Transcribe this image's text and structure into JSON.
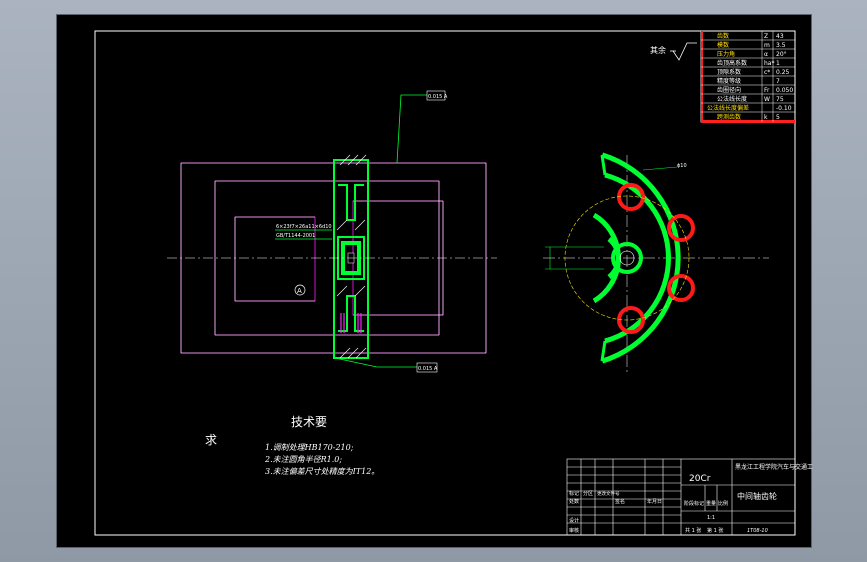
{
  "drawing": {
    "technical_requirements": {
      "title": "技术要",
      "title_tail": "求",
      "items": [
        "1.调制处理HB170-210;",
        "2.未注圆角半径R1.0;",
        "3.未注偏差尺寸处精度为IT12。"
      ]
    },
    "roughness_note": "其余",
    "title_block": {
      "material": "20Cr",
      "university": "黑龙江工程学院汽车与交通工程学院",
      "part_name": "中间轴齿轮",
      "drawing_no": "1T08-10",
      "scale": "1:1",
      "labels": [
        "标记",
        "处数",
        "分区",
        "更改文件号",
        "签名",
        "年月日",
        "设计",
        "标准化",
        "审核",
        "工艺",
        "批准",
        "阶段标记",
        "重量",
        "比例",
        "共 1 张",
        "第 1 张"
      ]
    },
    "params_table": {
      "rows": [
        {
          "name": "齿数",
          "sym": "Z",
          "val": "43"
        },
        {
          "name": "模数",
          "sym": "m",
          "val": "3.5"
        },
        {
          "name": "压力角",
          "sym": "α",
          "val": "20°"
        },
        {
          "name": "齿顶高系数",
          "sym": "ha*",
          "val": "1"
        },
        {
          "name": "顶隙系数",
          "sym": "c*",
          "val": "0.25"
        },
        {
          "name": "精度等级",
          "sym": "",
          "val": "7"
        },
        {
          "name": "齿圈径向",
          "sym": "Fr",
          "val": "0.050"
        },
        {
          "name": "公法线长度",
          "sym": "W",
          "val": "75"
        },
        {
          "name": "公法线长度偏差",
          "sym": "",
          "val": "-0.10"
        },
        {
          "name": "跨测齿数",
          "sym": "k",
          "val": "5"
        }
      ]
    },
    "annotations": {
      "flag_top": "0.015 A",
      "flag_bottom": "0.015 A",
      "datum": "A",
      "bore_label": "ϕ10",
      "keyway_note": "GB/T1144-2001",
      "spline_note": "6×23f7×26a11×6d10"
    }
  }
}
